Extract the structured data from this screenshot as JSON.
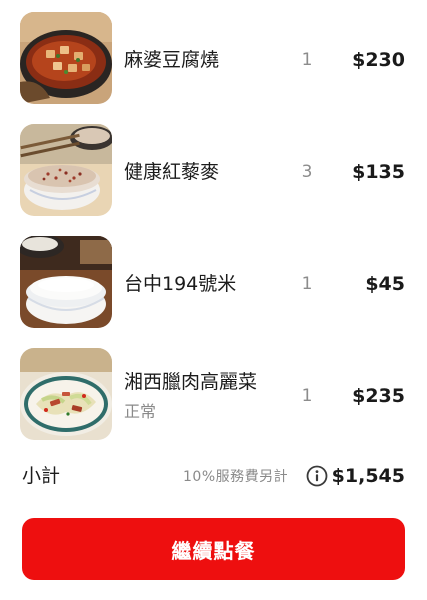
{
  "cart": {
    "items": [
      {
        "name": "麻婆豆腐燒",
        "note": "",
        "qty": "1",
        "price": "$230",
        "image": "mapo-tofu-photo"
      },
      {
        "name": "健康紅藜麥",
        "note": "",
        "qty": "3",
        "price": "$135",
        "image": "red-quinoa-rice-bowl-photo"
      },
      {
        "name": "台中194號米",
        "note": "",
        "qty": "1",
        "price": "$45",
        "image": "white-rice-bowl-photo"
      },
      {
        "name": "湘西臘肉高麗菜",
        "note": "正常",
        "qty": "1",
        "price": "$235",
        "image": "cured-pork-cabbage-photo"
      }
    ]
  },
  "summary": {
    "subtotal_label": "小計",
    "fee_note": "10%服務費另計",
    "fee_info_icon": "info-circle-icon",
    "subtotal_value": "$1,545"
  },
  "actions": {
    "continue_label": "繼續點餐"
  },
  "colors": {
    "accent": "#ee0f0f",
    "muted_text": "#8a8a8a"
  }
}
